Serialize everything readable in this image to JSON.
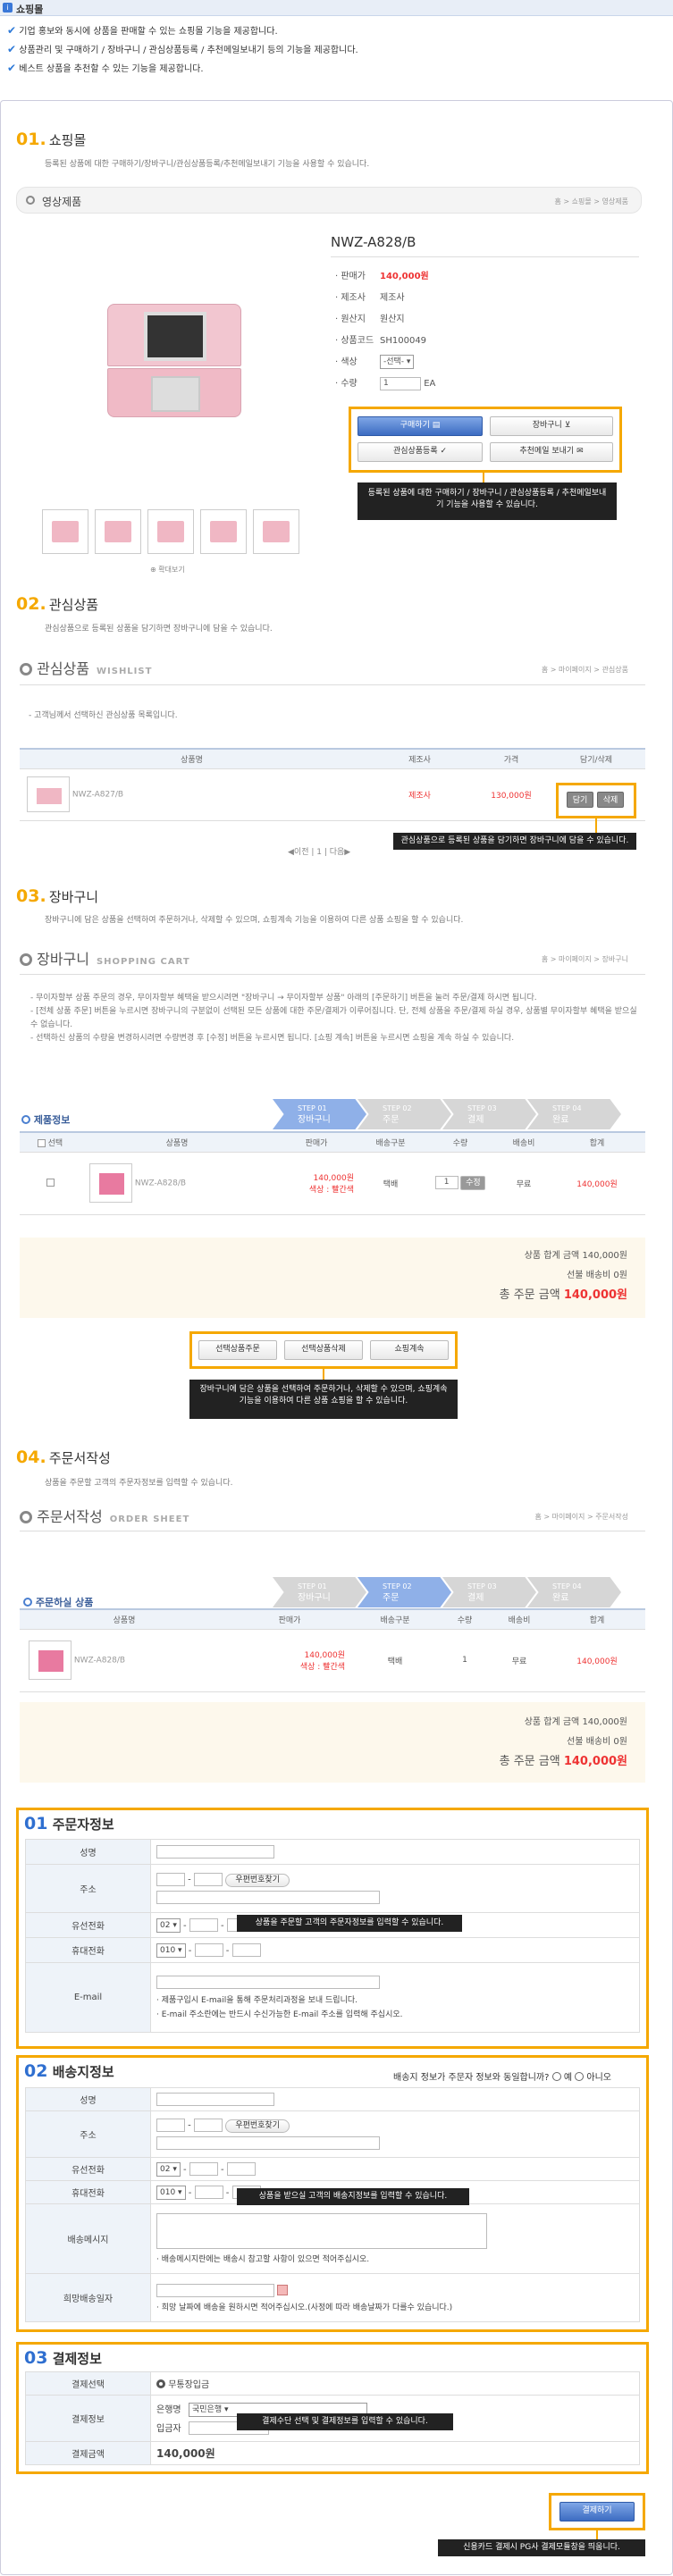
{
  "top": {
    "title": "쇼핑몰",
    "checks": [
      "기업 홍보와 동시에 상품을 판매할 수 있는 쇼핑몰 기능을 제공합니다.",
      "상품관리 및 구매하기 / 장바구니 / 관심상품등록 / 추천메일보내기 등의 기능을 제공합니다.",
      "베스트 상품을 추천할 수 있는 기능을 제공합니다."
    ]
  },
  "s1": {
    "num": "01.",
    "title": "쇼핑몰",
    "desc": "등록된 상품에 대한 구매하기/장바구니/관심상품등록/추천메일보내기 기능을 사용할 수 있습니다.",
    "bar": "영상제품",
    "crumb": "홈 > 쇼핑몰 > 영상제품",
    "product": "NWZ-A828/B",
    "fields": [
      {
        "k": "판매가",
        "v": "140,000원"
      },
      {
        "k": "제조사",
        "v": "제조사"
      },
      {
        "k": "원산지",
        "v": "원산지"
      },
      {
        "k": "상품코드",
        "v": "SH100049"
      },
      {
        "k": "색상",
        "v": "-선택-"
      },
      {
        "k": "수량",
        "v": "1"
      }
    ],
    "unit": "EA",
    "buy": "구매하기",
    "cart": "장바구니",
    "wish": "관심상품등록",
    "mail": "추천메일 보내기",
    "tip": "등록된 상품에 대한 구매하기 / 장바구니 / 관심상품등록 / 추천메일보내기 기능을 사용할 수 있습니다.",
    "zoom": "확대보기"
  },
  "s2": {
    "num": "02.",
    "title": "관심상품",
    "desc": "관심상품으로 등록된 상품을 담기하면 장바구니에 담을 수 있습니다.",
    "head": "관심상품",
    "head_en": "WISHLIST",
    "crumb": "홈 > 마이페이지 > 관심상품",
    "note": "- 고객님께서 선택하신 관심상품 목록입니다.",
    "cols": [
      "상품명",
      "제조사",
      "가격",
      "담기/삭제"
    ],
    "row": {
      "name": "NWZ-A827/B",
      "maker": "제조사",
      "price": "130,000원",
      "add": "담기",
      "del": "삭제"
    },
    "pager": "◀이전 | 1 | 다음▶",
    "tip": "관심상품으로 등록된 상품을 담기하면 장바구니에 담을 수 있습니다."
  },
  "s3": {
    "num": "03.",
    "title": "장바구니",
    "desc": "장바구니에 담은 상품을 선택하여 주문하거나, 삭제할 수 있으며, 쇼핑계속 기능을 이용하여 다른 상품 쇼핑을 할 수 있습니다.",
    "head": "장바구니",
    "head_en": "SHOPPING CART",
    "crumb": "홈 > 마이페이지 > 장바구니",
    "notes": [
      "- 무이자할부 상품 주문의 경우, 무이자할부 혜택을 받으시려면 \"장바구니 → 무이자할부 상품\" 아래의 [주문하기] 버튼을 눌러 주문/결제 하시면 됩니다.",
      "- [전체 상품 주문] 버튼을 누르시면 장바구니의 구분없이 선택된 모든 상품에 대한 주문/결제가 이루어집니다. 단, 전체 상품을 주문/결제 하실 경우, 상품별 무이자할부 혜택을 받으실 수 없습니다.",
      "- 선택하신 상품의 수량을 변경하시려면 수량변경 후 [수정] 버튼을 누르시면 됩니다. [쇼핑 계속] 버튼을 누르시면 쇼핑을 계속 하실 수 있습니다."
    ],
    "label": "제품정보",
    "steps": [
      {
        "n": "STEP 01",
        "t": "장바구니"
      },
      {
        "n": "STEP 02",
        "t": "주문"
      },
      {
        "n": "STEP 03",
        "t": "결제"
      },
      {
        "n": "STEP 04",
        "t": "완료"
      }
    ],
    "cols": [
      "선택",
      "상품명",
      "판매가",
      "배송구분",
      "수량",
      "배송비",
      "합계"
    ],
    "row": {
      "name": "NWZ-A828/B",
      "price": "140,000원",
      "color": "색상 : 빨간색",
      "ship": "택배",
      "qty": "1",
      "edit": "수정",
      "fee": "무료",
      "total": "140,000원"
    },
    "sum1": "상품 합계 금액 140,000원",
    "sum2": "선불 배송비 0원",
    "sumlabel": "총 주문 금액",
    "sum3": "140,000원",
    "b1": "선택상품주문",
    "b2": "선택상품삭제",
    "b3": "쇼핑계속",
    "tip": "장바구니에 담은 상품을 선택하여 주문하거나, 삭제할 수 있으며, 쇼핑계속 기능을 이용하여 다른 상품 쇼핑을 할 수 있습니다."
  },
  "s4": {
    "num": "04.",
    "title": "주문서작성",
    "desc": "상품을 주문할 고객의 주문자정보를 입력할 수 있습니다.",
    "head": "주문서작성",
    "head_en": "ORDER SHEET",
    "crumb": "홈 > 마이페이지 > 주문서작성",
    "label": "주문하실 상품",
    "steps": [
      {
        "n": "STEP 01",
        "t": "장바구니"
      },
      {
        "n": "STEP 02",
        "t": "주문"
      },
      {
        "n": "STEP 03",
        "t": "결제"
      },
      {
        "n": "STEP 04",
        "t": "완료"
      }
    ],
    "cols": [
      "상품명",
      "판매가",
      "배송구분",
      "수량",
      "배송비",
      "합계"
    ],
    "row": {
      "name": "NWZ-A828/B",
      "price": "140,000원",
      "color": "색상 : 빨간색",
      "ship": "택배",
      "qty": "1",
      "fee": "무료",
      "total": "140,000원"
    },
    "sum1": "상품 합계 금액 140,000원",
    "sum2": "선불 배송비 0원",
    "sumlabel": "총 주문 금액",
    "sum3": "140,000원"
  },
  "f1": {
    "num": "01",
    "title": "주문자정보",
    "labels": [
      "성명",
      "주소",
      "유선전화",
      "휴대전화",
      "E-mail"
    ],
    "zip": "우편번호찾기",
    "tel": "02",
    "mobile": "010",
    "tip": "상품을 주문할 고객의 주문자정보를 입력할 수 있습니다.",
    "email1": "· 제품구입시 E-mail을 통해 주문처리과정을 보내 드립니다.",
    "email2": "· E-mail 주소란에는 반드시 수신가능한 E-mail 주소를 입력해 주십시오."
  },
  "f2": {
    "num": "02",
    "title": "배송지정보",
    "question": "배송지 정보가 주문자 정보와 동일합니까?",
    "yes": "예",
    "no": "아니오",
    "labels": [
      "성명",
      "주소",
      "유선전화",
      "휴대전화",
      "배송메시지",
      "희망배송일자"
    ],
    "zip": "우편번호찾기",
    "tel": "02",
    "mobile": "010",
    "tip": "상품을 받으실 고객의 배송지정보를 입력할 수 있습니다.",
    "msgnote": "· 배송메시지란에는 배송시 참고할 사항이 있으면 적어주십시오.",
    "datenote": "· 희망 날짜에 배송을 원하시면 적어주십시오.(사정에 따라 배송날짜가 다를수 있습니다.)"
  },
  "f3": {
    "num": "03",
    "title": "결제정보",
    "labels": [
      "결제선택",
      "결제정보",
      "결제금액"
    ],
    "method": "무통장입금",
    "bank": "은행명",
    "bankval": "국민은행",
    "payer": "입금자",
    "tip": "결제수단 선택 및 결제정보를 입력할 수 있습니다.",
    "amount": "140,000원"
  },
  "final": {
    "pay": "결제하기",
    "tip": "신용카드 결제시 PG사 결제모듈창을 띄웁니다."
  }
}
